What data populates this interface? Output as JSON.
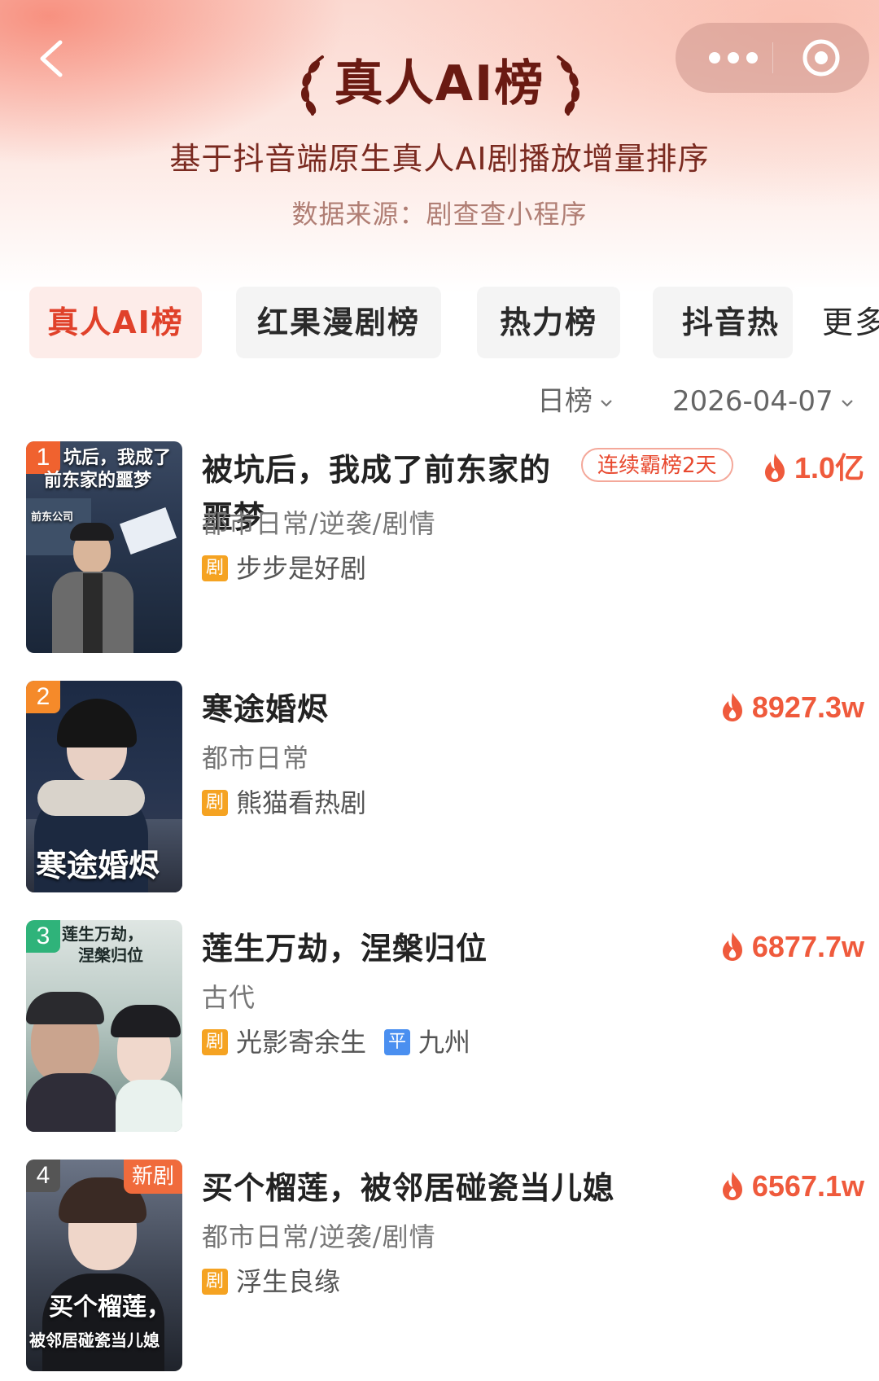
{
  "header": {
    "title": "真人AI榜",
    "subtitle": "基于抖音端原生真人AI剧播放增量排序",
    "source": "数据来源：剧查查小程序"
  },
  "tabs": [
    {
      "label": "真人AI榜",
      "active": true
    },
    {
      "label": "红果漫剧榜",
      "active": false
    },
    {
      "label": "热力榜",
      "active": false
    },
    {
      "label": "抖音热",
      "active": false
    }
  ],
  "more_label": "更多",
  "filters": {
    "period": "日榜",
    "date": "2026-04-07"
  },
  "items": [
    {
      "rank": "1",
      "name_line1": "被坑后，我成了前东家的",
      "name_line2": "噩梦",
      "streak": "连续霸榜2天",
      "heat": "1.0亿",
      "genre": "都市日常/逆袭/剧情",
      "producers": [
        {
          "badge": "剧",
          "name": "步步是好剧"
        }
      ],
      "poster_text": [
        "坑后，我成了",
        "前东家的噩梦"
      ],
      "poster_sign": "前东公司"
    },
    {
      "rank": "2",
      "name_line1": "寒途婚烬",
      "heat": "8927.3w",
      "genre": "都市日常",
      "producers": [
        {
          "badge": "剧",
          "name": "熊猫看热剧"
        }
      ],
      "poster_text": [
        "寒途婚烬"
      ]
    },
    {
      "rank": "3",
      "name_line1": "莲生万劫，涅槃归位",
      "heat": "6877.7w",
      "genre": "古代",
      "producers": [
        {
          "badge": "剧",
          "name": "光影寄余生"
        },
        {
          "badge": "平",
          "name": "九州"
        }
      ],
      "poster_text": [
        "莲生万劫，",
        "涅槃归位"
      ]
    },
    {
      "rank": "4",
      "new_tag": "新剧",
      "name_line1": "买个榴莲，被邻居碰瓷当儿媳",
      "heat": "6567.1w",
      "genre": "都市日常/逆袭/剧情",
      "producers": [
        {
          "badge": "剧",
          "name": "浮生良缘"
        }
      ],
      "poster_text": [
        "买个榴莲，",
        "被邻居碰瓷当儿媳"
      ]
    }
  ],
  "colors": {
    "accent": "#e0412a",
    "heat": "#ef5a3c",
    "rank1": "#f0622f",
    "rank2": "#f58a2a",
    "rank3": "#2fb37a",
    "rank4": "#555555",
    "badge_ju": "#f5a322",
    "badge_ping": "#4a8ff0"
  }
}
